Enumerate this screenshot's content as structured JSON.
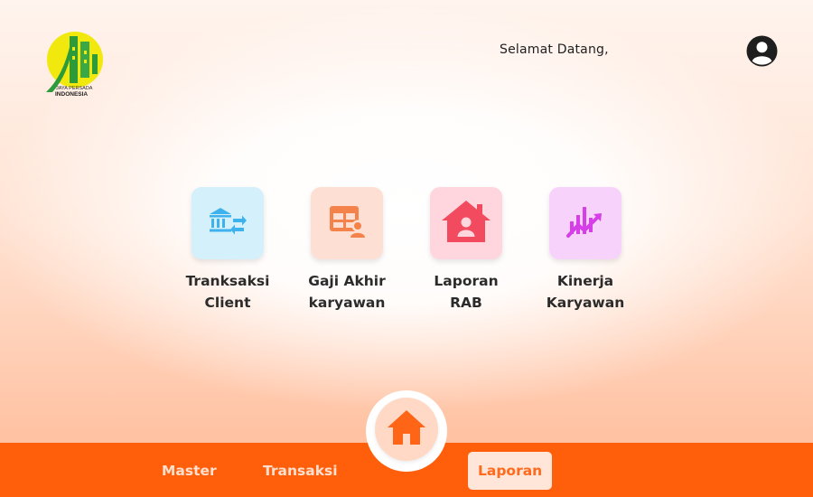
{
  "header": {
    "greeting": "Selamat Datang,",
    "logo_text_line1": "JAYA PERSADA",
    "logo_text_line2": "INDONESIA",
    "avatar_icon": "user-circle-icon"
  },
  "menu": [
    {
      "label": "Tranksaksi\nClient",
      "icon": "bank-transfer-icon",
      "tile_color": "#d4f0fb",
      "icon_color": "#3eb2ec"
    },
    {
      "label": "Gaji Akhir\nkaryawan",
      "icon": "payroll-table-icon",
      "tile_color": "#fde0d3",
      "icon_color": "#f3834a"
    },
    {
      "label": "Laporan\nRAB",
      "icon": "house-user-icon",
      "tile_color": "#ffd6de",
      "icon_color": "#f24a5e"
    },
    {
      "label": "Kinerja\nKaryawan",
      "icon": "performance-chart-icon",
      "tile_color": "#f7d3fb",
      "icon_color": "#d63ee7"
    }
  ],
  "bottom_nav": {
    "items": [
      "Master",
      "Transaksi",
      "Laporan"
    ],
    "active": "Laporan",
    "home_icon": "home-icon",
    "bar_color": "#ff5f0b"
  }
}
